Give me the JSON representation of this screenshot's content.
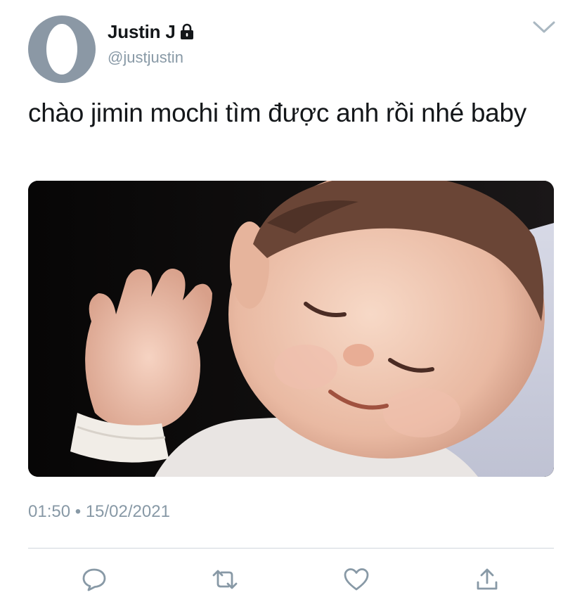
{
  "tweet": {
    "display_name": "Justin J",
    "handle": "@justjustin",
    "text": "chào jimin mochi tìm được anh rồi nhé baby",
    "time": "01:50",
    "separator": "•",
    "date": "15/02/2021"
  },
  "media": {
    "description_icon": "photo-of-smiling-baby-waving"
  },
  "actions": [
    {
      "name": "reply-icon"
    },
    {
      "name": "retweet-icon"
    },
    {
      "name": "like-icon"
    },
    {
      "name": "share-icon"
    }
  ],
  "colors": {
    "text": "#14171a",
    "secondary": "#8899a6",
    "avatar": "#8b98a5",
    "divider": "#cfd6dc"
  }
}
